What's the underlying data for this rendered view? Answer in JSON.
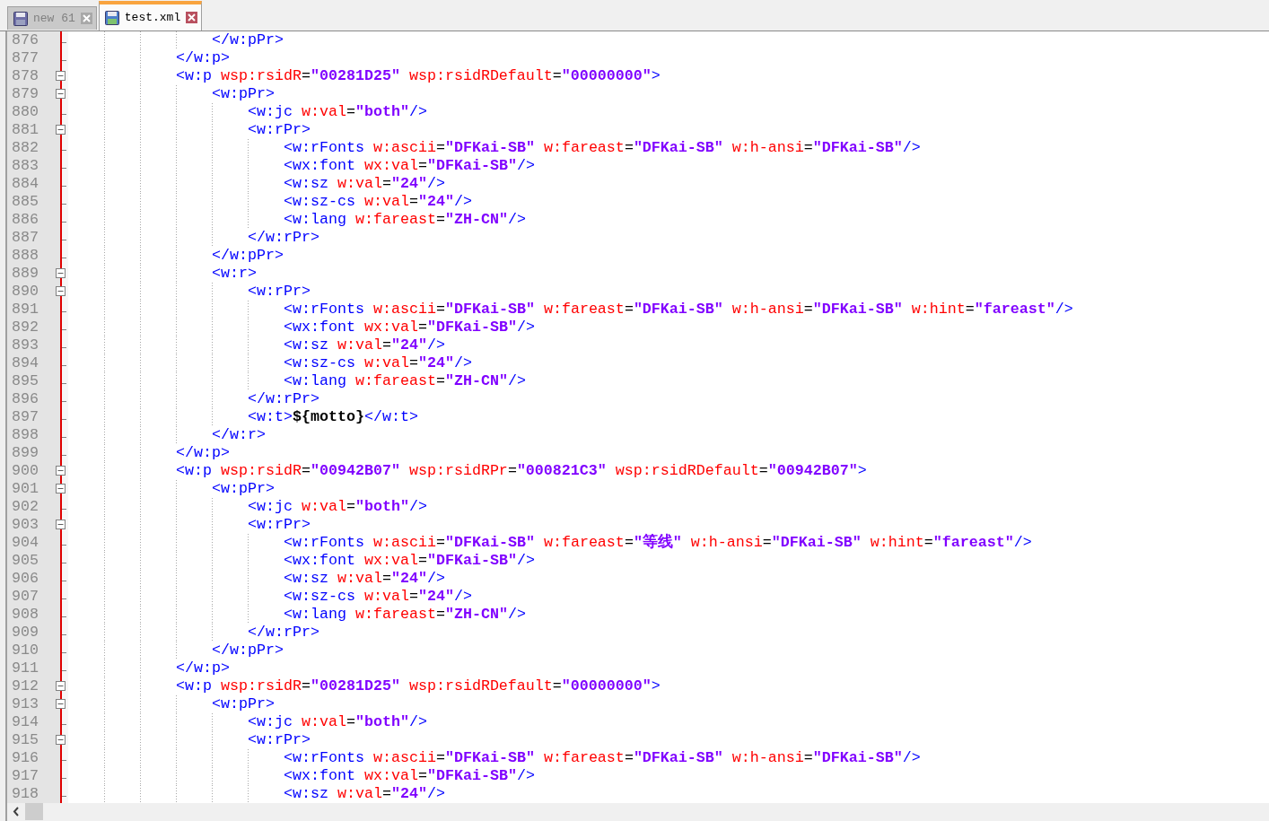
{
  "tabs": [
    {
      "label": "new 61",
      "selected": false
    },
    {
      "label": "test.xml",
      "selected": true
    }
  ],
  "lines": [
    {
      "children": [
        {
          "number": "876",
          "foldable": false,
          "tokens": [
            {
              "kind": "tag",
              "text": "</w:pPr>"
            }
          ]
        }
      ]
    },
    {
      "number": "877",
      "foldable": false,
      "tokens": [
        {
          "kind": "tag",
          "text": "</w:p>"
        }
      ]
    },
    {
      "number": "878",
      "foldable": true,
      "tokens": [
        {
          "kind": "tag",
          "text": "<w:p"
        },
        {
          "kind": "attr",
          "text": " wsp:rsidR"
        },
        {
          "kind": "eq",
          "text": "="
        },
        {
          "kind": "value",
          "text": "\"00281D25\""
        },
        {
          "kind": "attr",
          "text": " wsp:rsidRDefault"
        },
        {
          "kind": "eq",
          "text": "="
        },
        {
          "kind": "value",
          "text": "\"00000000\""
        },
        {
          "kind": "tag",
          "text": ">"
        }
      ],
      "children": [
        {
          "number": "879",
          "foldable": true,
          "tokens": [
            {
              "kind": "tag",
              "text": "<w:pPr>"
            }
          ],
          "children": [
            {
              "number": "880",
              "foldable": false,
              "tokens": [
                {
                  "kind": "tag",
                  "text": "<w:jc"
                },
                {
                  "kind": "attr",
                  "text": " w:val"
                },
                {
                  "kind": "eq",
                  "text": "="
                },
                {
                  "kind": "value",
                  "text": "\"both\""
                },
                {
                  "kind": "tag",
                  "text": "/>"
                }
              ]
            },
            {
              "number": "881",
              "foldable": true,
              "tokens": [
                {
                  "kind": "tag",
                  "text": "<w:rPr>"
                }
              ],
              "children": [
                {
                  "number": "882",
                  "foldable": false,
                  "tokens": [
                    {
                      "kind": "tag",
                      "text": "<w:rFonts"
                    },
                    {
                      "kind": "attr",
                      "text": " w:ascii"
                    },
                    {
                      "kind": "eq",
                      "text": "="
                    },
                    {
                      "kind": "value",
                      "text": "\"DFKai-SB\""
                    },
                    {
                      "kind": "attr",
                      "text": " w:fareast"
                    },
                    {
                      "kind": "eq",
                      "text": "="
                    },
                    {
                      "kind": "value",
                      "text": "\"DFKai-SB\""
                    },
                    {
                      "kind": "attr",
                      "text": " w:h-ansi"
                    },
                    {
                      "kind": "eq",
                      "text": "="
                    },
                    {
                      "kind": "value",
                      "text": "\"DFKai-SB\""
                    },
                    {
                      "kind": "tag",
                      "text": "/>"
                    }
                  ]
                },
                {
                  "number": "883",
                  "foldable": false,
                  "tokens": [
                    {
                      "kind": "tag",
                      "text": "<wx:font"
                    },
                    {
                      "kind": "attr",
                      "text": " wx:val"
                    },
                    {
                      "kind": "eq",
                      "text": "="
                    },
                    {
                      "kind": "value",
                      "text": "\"DFKai-SB\""
                    },
                    {
                      "kind": "tag",
                      "text": "/>"
                    }
                  ]
                },
                {
                  "number": "884",
                  "foldable": false,
                  "tokens": [
                    {
                      "kind": "tag",
                      "text": "<w:sz"
                    },
                    {
                      "kind": "attr",
                      "text": " w:val"
                    },
                    {
                      "kind": "eq",
                      "text": "="
                    },
                    {
                      "kind": "value",
                      "text": "\"24\""
                    },
                    {
                      "kind": "tag",
                      "text": "/>"
                    }
                  ]
                },
                {
                  "number": "885",
                  "foldable": false,
                  "tokens": [
                    {
                      "kind": "tag",
                      "text": "<w:sz-cs"
                    },
                    {
                      "kind": "attr",
                      "text": " w:val"
                    },
                    {
                      "kind": "eq",
                      "text": "="
                    },
                    {
                      "kind": "value",
                      "text": "\"24\""
                    },
                    {
                      "kind": "tag",
                      "text": "/>"
                    }
                  ]
                },
                {
                  "number": "886",
                  "foldable": false,
                  "tokens": [
                    {
                      "kind": "tag",
                      "text": "<w:lang"
                    },
                    {
                      "kind": "attr",
                      "text": " w:fareast"
                    },
                    {
                      "kind": "eq",
                      "text": "="
                    },
                    {
                      "kind": "value",
                      "text": "\"ZH-CN\""
                    },
                    {
                      "kind": "tag",
                      "text": "/>"
                    }
                  ]
                }
              ]
            },
            {
              "number": "887",
              "foldable": false,
              "tokens": [
                {
                  "kind": "tag",
                  "text": "</w:rPr>"
                }
              ]
            }
          ]
        },
        {
          "number": "888",
          "foldable": false,
          "tokens": [
            {
              "kind": "tag",
              "text": "</w:pPr>"
            }
          ]
        },
        {
          "number": "889",
          "foldable": true,
          "tokens": [
            {
              "kind": "tag",
              "text": "<w:r>"
            }
          ],
          "children": [
            {
              "number": "890",
              "foldable": true,
              "tokens": [
                {
                  "kind": "tag",
                  "text": "<w:rPr>"
                }
              ],
              "children": [
                {
                  "number": "891",
                  "foldable": false,
                  "tokens": [
                    {
                      "kind": "tag",
                      "text": "<w:rFonts"
                    },
                    {
                      "kind": "attr",
                      "text": " w:ascii"
                    },
                    {
                      "kind": "eq",
                      "text": "="
                    },
                    {
                      "kind": "value",
                      "text": "\"DFKai-SB\""
                    },
                    {
                      "kind": "attr",
                      "text": " w:fareast"
                    },
                    {
                      "kind": "eq",
                      "text": "="
                    },
                    {
                      "kind": "value",
                      "text": "\"DFKai-SB\""
                    },
                    {
                      "kind": "attr",
                      "text": " w:h-ansi"
                    },
                    {
                      "kind": "eq",
                      "text": "="
                    },
                    {
                      "kind": "value",
                      "text": "\"DFKai-SB\""
                    },
                    {
                      "kind": "attr",
                      "text": " w:hint"
                    },
                    {
                      "kind": "eq",
                      "text": "="
                    },
                    {
                      "kind": "value",
                      "text": "\"fareast\""
                    },
                    {
                      "kind": "tag",
                      "text": "/>"
                    }
                  ]
                },
                {
                  "number": "892",
                  "foldable": false,
                  "tokens": [
                    {
                      "kind": "tag",
                      "text": "<wx:font"
                    },
                    {
                      "kind": "attr",
                      "text": " wx:val"
                    },
                    {
                      "kind": "eq",
                      "text": "="
                    },
                    {
                      "kind": "value",
                      "text": "\"DFKai-SB\""
                    },
                    {
                      "kind": "tag",
                      "text": "/>"
                    }
                  ]
                },
                {
                  "number": "893",
                  "foldable": false,
                  "tokens": [
                    {
                      "kind": "tag",
                      "text": "<w:sz"
                    },
                    {
                      "kind": "attr",
                      "text": " w:val"
                    },
                    {
                      "kind": "eq",
                      "text": "="
                    },
                    {
                      "kind": "value",
                      "text": "\"24\""
                    },
                    {
                      "kind": "tag",
                      "text": "/>"
                    }
                  ]
                },
                {
                  "number": "894",
                  "foldable": false,
                  "tokens": [
                    {
                      "kind": "tag",
                      "text": "<w:sz-cs"
                    },
                    {
                      "kind": "attr",
                      "text": " w:val"
                    },
                    {
                      "kind": "eq",
                      "text": "="
                    },
                    {
                      "kind": "value",
                      "text": "\"24\""
                    },
                    {
                      "kind": "tag",
                      "text": "/>"
                    }
                  ]
                },
                {
                  "number": "895",
                  "foldable": false,
                  "tokens": [
                    {
                      "kind": "tag",
                      "text": "<w:lang"
                    },
                    {
                      "kind": "attr",
                      "text": " w:fareast"
                    },
                    {
                      "kind": "eq",
                      "text": "="
                    },
                    {
                      "kind": "value",
                      "text": "\"ZH-CN\""
                    },
                    {
                      "kind": "tag",
                      "text": "/>"
                    }
                  ]
                }
              ]
            },
            {
              "number": "896",
              "foldable": false,
              "tokens": [
                {
                  "kind": "tag",
                  "text": "</w:rPr>"
                }
              ]
            },
            {
              "number": "897",
              "foldable": false,
              "tokens": [
                {
                  "kind": "tag",
                  "text": "<w:t>"
                },
                {
                  "kind": "text",
                  "text": "${motto}"
                },
                {
                  "kind": "tag",
                  "text": "</w:t>"
                }
              ]
            }
          ]
        },
        {
          "number": "898",
          "foldable": false,
          "tokens": [
            {
              "kind": "tag",
              "text": "</w:r>"
            }
          ]
        }
      ]
    },
    {
      "number": "899",
      "foldable": false,
      "tokens": [
        {
          "kind": "tag",
          "text": "</w:p>"
        }
      ]
    },
    {
      "number": "900",
      "foldable": true,
      "tokens": [
        {
          "kind": "tag",
          "text": "<w:p"
        },
        {
          "kind": "attr",
          "text": " wsp:rsidR"
        },
        {
          "kind": "eq",
          "text": "="
        },
        {
          "kind": "value",
          "text": "\"00942B07\""
        },
        {
          "kind": "attr",
          "text": " wsp:rsidRPr"
        },
        {
          "kind": "eq",
          "text": "="
        },
        {
          "kind": "value",
          "text": "\"000821C3\""
        },
        {
          "kind": "attr",
          "text": " wsp:rsidRDefault"
        },
        {
          "kind": "eq",
          "text": "="
        },
        {
          "kind": "value",
          "text": "\"00942B07\""
        },
        {
          "kind": "tag",
          "text": ">"
        }
      ],
      "children": [
        {
          "number": "901",
          "foldable": true,
          "tokens": [
            {
              "kind": "tag",
              "text": "<w:pPr>"
            }
          ],
          "children": [
            {
              "number": "902",
              "foldable": false,
              "tokens": [
                {
                  "kind": "tag",
                  "text": "<w:jc"
                },
                {
                  "kind": "attr",
                  "text": " w:val"
                },
                {
                  "kind": "eq",
                  "text": "="
                },
                {
                  "kind": "value",
                  "text": "\"both\""
                },
                {
                  "kind": "tag",
                  "text": "/>"
                }
              ]
            },
            {
              "number": "903",
              "foldable": true,
              "tokens": [
                {
                  "kind": "tag",
                  "text": "<w:rPr>"
                }
              ],
              "children": [
                {
                  "number": "904",
                  "foldable": false,
                  "tokens": [
                    {
                      "kind": "tag",
                      "text": "<w:rFonts"
                    },
                    {
                      "kind": "attr",
                      "text": " w:ascii"
                    },
                    {
                      "kind": "eq",
                      "text": "="
                    },
                    {
                      "kind": "value",
                      "text": "\"DFKai-SB\""
                    },
                    {
                      "kind": "attr",
                      "text": " w:fareast"
                    },
                    {
                      "kind": "eq",
                      "text": "="
                    },
                    {
                      "kind": "value",
                      "text": "\"等线\""
                    },
                    {
                      "kind": "attr",
                      "text": " w:h-ansi"
                    },
                    {
                      "kind": "eq",
                      "text": "="
                    },
                    {
                      "kind": "value",
                      "text": "\"DFKai-SB\""
                    },
                    {
                      "kind": "attr",
                      "text": " w:hint"
                    },
                    {
                      "kind": "eq",
                      "text": "="
                    },
                    {
                      "kind": "value",
                      "text": "\"fareast\""
                    },
                    {
                      "kind": "tag",
                      "text": "/>"
                    }
                  ]
                },
                {
                  "number": "905",
                  "foldable": false,
                  "tokens": [
                    {
                      "kind": "tag",
                      "text": "<wx:font"
                    },
                    {
                      "kind": "attr",
                      "text": " wx:val"
                    },
                    {
                      "kind": "eq",
                      "text": "="
                    },
                    {
                      "kind": "value",
                      "text": "\"DFKai-SB\""
                    },
                    {
                      "kind": "tag",
                      "text": "/>"
                    }
                  ]
                },
                {
                  "number": "906",
                  "foldable": false,
                  "tokens": [
                    {
                      "kind": "tag",
                      "text": "<w:sz"
                    },
                    {
                      "kind": "attr",
                      "text": " w:val"
                    },
                    {
                      "kind": "eq",
                      "text": "="
                    },
                    {
                      "kind": "value",
                      "text": "\"24\""
                    },
                    {
                      "kind": "tag",
                      "text": "/>"
                    }
                  ]
                },
                {
                  "number": "907",
                  "foldable": false,
                  "tokens": [
                    {
                      "kind": "tag",
                      "text": "<w:sz-cs"
                    },
                    {
                      "kind": "attr",
                      "text": " w:val"
                    },
                    {
                      "kind": "eq",
                      "text": "="
                    },
                    {
                      "kind": "value",
                      "text": "\"24\""
                    },
                    {
                      "kind": "tag",
                      "text": "/>"
                    }
                  ]
                },
                {
                  "number": "908",
                  "foldable": false,
                  "tokens": [
                    {
                      "kind": "tag",
                      "text": "<w:lang"
                    },
                    {
                      "kind": "attr",
                      "text": " w:fareast"
                    },
                    {
                      "kind": "eq",
                      "text": "="
                    },
                    {
                      "kind": "value",
                      "text": "\"ZH-CN\""
                    },
                    {
                      "kind": "tag",
                      "text": "/>"
                    }
                  ]
                }
              ]
            },
            {
              "number": "909",
              "foldable": false,
              "tokens": [
                {
                  "kind": "tag",
                  "text": "</w:rPr>"
                }
              ]
            }
          ]
        },
        {
          "number": "910",
          "foldable": false,
          "tokens": [
            {
              "kind": "tag",
              "text": "</w:pPr>"
            }
          ]
        }
      ]
    },
    {
      "number": "911",
      "foldable": false,
      "tokens": [
        {
          "kind": "tag",
          "text": "</w:p>"
        }
      ]
    },
    {
      "number": "912",
      "foldable": true,
      "tokens": [
        {
          "kind": "tag",
          "text": "<w:p"
        },
        {
          "kind": "attr",
          "text": " wsp:rsidR"
        },
        {
          "kind": "eq",
          "text": "="
        },
        {
          "kind": "value",
          "text": "\"00281D25\""
        },
        {
          "kind": "attr",
          "text": " wsp:rsidRDefault"
        },
        {
          "kind": "eq",
          "text": "="
        },
        {
          "kind": "value",
          "text": "\"00000000\""
        },
        {
          "kind": "tag",
          "text": ">"
        }
      ],
      "children": [
        {
          "number": "913",
          "foldable": true,
          "tokens": [
            {
              "kind": "tag",
              "text": "<w:pPr>"
            }
          ],
          "children": [
            {
              "number": "914",
              "foldable": false,
              "tokens": [
                {
                  "kind": "tag",
                  "text": "<w:jc"
                },
                {
                  "kind": "attr",
                  "text": " w:val"
                },
                {
                  "kind": "eq",
                  "text": "="
                },
                {
                  "kind": "value",
                  "text": "\"both\""
                },
                {
                  "kind": "tag",
                  "text": "/>"
                }
              ]
            },
            {
              "number": "915",
              "foldable": true,
              "tokens": [
                {
                  "kind": "tag",
                  "text": "<w:rPr>"
                }
              ],
              "children": [
                {
                  "number": "916",
                  "foldable": false,
                  "tokens": [
                    {
                      "kind": "tag",
                      "text": "<w:rFonts"
                    },
                    {
                      "kind": "attr",
                      "text": " w:ascii"
                    },
                    {
                      "kind": "eq",
                      "text": "="
                    },
                    {
                      "kind": "value",
                      "text": "\"DFKai-SB\""
                    },
                    {
                      "kind": "attr",
                      "text": " w:fareast"
                    },
                    {
                      "kind": "eq",
                      "text": "="
                    },
                    {
                      "kind": "value",
                      "text": "\"DFKai-SB\""
                    },
                    {
                      "kind": "attr",
                      "text": " w:h-ansi"
                    },
                    {
                      "kind": "eq",
                      "text": "="
                    },
                    {
                      "kind": "value",
                      "text": "\"DFKai-SB\""
                    },
                    {
                      "kind": "tag",
                      "text": "/>"
                    }
                  ]
                },
                {
                  "number": "917",
                  "foldable": false,
                  "tokens": [
                    {
                      "kind": "tag",
                      "text": "<wx:font"
                    },
                    {
                      "kind": "attr",
                      "text": " wx:val"
                    },
                    {
                      "kind": "eq",
                      "text": "="
                    },
                    {
                      "kind": "value",
                      "text": "\"DFKai-SB\""
                    },
                    {
                      "kind": "tag",
                      "text": "/>"
                    }
                  ]
                },
                {
                  "number": "918",
                  "foldable": false,
                  "tokens": [
                    {
                      "kind": "tag",
                      "text": "<w:sz"
                    },
                    {
                      "kind": "attr",
                      "text": " w:val"
                    },
                    {
                      "kind": "eq",
                      "text": "="
                    },
                    {
                      "kind": "value",
                      "text": "\"24\""
                    },
                    {
                      "kind": "tag",
                      "text": "/>"
                    }
                  ]
                }
              ]
            }
          ]
        }
      ]
    }
  ]
}
